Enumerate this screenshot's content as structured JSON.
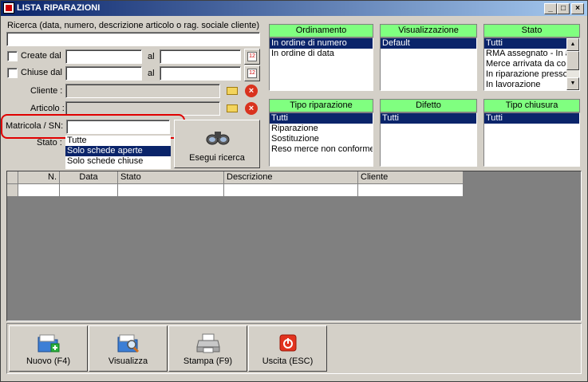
{
  "window": {
    "title": "LISTA RIPARAZIONI",
    "minimize": "_",
    "maximize": "□",
    "close": "×"
  },
  "search": {
    "label": "Ricerca (data, numero, descrizione articolo o rag. sociale cliente)",
    "value": ""
  },
  "created": {
    "label": "Create dal",
    "from": "",
    "al": "al",
    "to": "",
    "checked": false
  },
  "closed": {
    "label": "Chiuse dal",
    "from": "",
    "al": "al",
    "to": "",
    "checked": false
  },
  "cliente": {
    "label": "Cliente :",
    "value": ""
  },
  "articolo": {
    "label": "Articolo :",
    "value": ""
  },
  "matricola": {
    "label": "Matricola / SN:",
    "value": ""
  },
  "stato_filter": {
    "label": "Stato :",
    "options": [
      "Tutte",
      "Solo schede aperte",
      "Solo schede chiuse"
    ],
    "selected": "Solo schede aperte"
  },
  "search_button": {
    "label": "Esegui ricerca"
  },
  "panels": {
    "ordinamento": {
      "title": "Ordinamento",
      "items": [
        "In ordine di numero",
        "In ordine di data"
      ],
      "selected": "In ordine di numero"
    },
    "visualizzazione": {
      "title": "Visualizzazione",
      "items": [
        "Default"
      ],
      "selected": "Default"
    },
    "stato": {
      "title": "Stato",
      "items": [
        "Tutti",
        "RMA assegnato - In a",
        "Merce arrivata da cor",
        "In riparazione presso",
        "In lavorazione"
      ],
      "selected": "Tutti"
    },
    "tipo_riparazione": {
      "title": "Tipo riparazione",
      "items": [
        "Tutti",
        "Riparazione",
        "Sostituzione",
        "Reso merce non conforme"
      ],
      "selected": "Tutti"
    },
    "difetto": {
      "title": "Difetto",
      "items": [
        "Tutti"
      ],
      "selected": "Tutti"
    },
    "tipo_chiusura": {
      "title": "Tipo chiusura",
      "items": [
        "Tutti"
      ],
      "selected": "Tutti"
    }
  },
  "grid": {
    "columns": [
      "",
      "N.",
      "Data",
      "Stato",
      "Descrizione",
      "Cliente"
    ]
  },
  "toolbar": {
    "nuovo": "Nuovo (F4)",
    "visualizza": "Visualizza",
    "stampa": "Stampa (F9)",
    "uscita": "Uscita (ESC)"
  },
  "colors": {
    "title_start": "#0a246a",
    "title_end": "#a6caf0",
    "panel_header": "#80ff80",
    "selection": "#0a246a",
    "highlight": "#e00000"
  }
}
